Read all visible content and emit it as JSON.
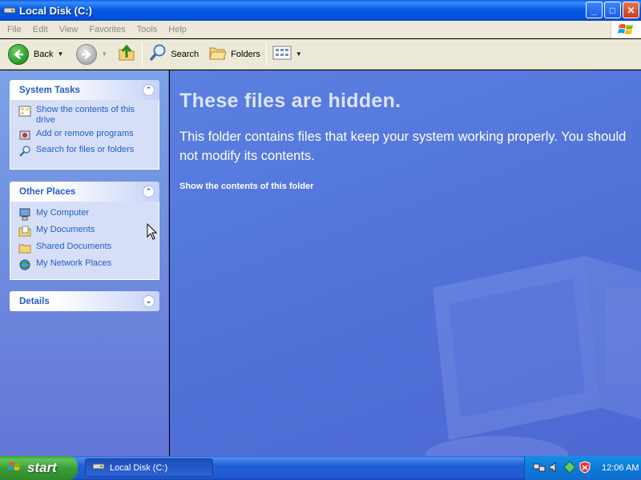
{
  "window": {
    "title": "Local Disk (C:)",
    "buttons": {
      "minimize": "_",
      "maximize": "□",
      "close": "✕"
    }
  },
  "menubar": {
    "items": [
      "File",
      "Edit",
      "View",
      "Favorites",
      "Tools",
      "Help"
    ]
  },
  "toolbar": {
    "back_label": "Back",
    "search_label": "Search",
    "folders_label": "Folders"
  },
  "sidebar": {
    "system_tasks": {
      "title": "System Tasks",
      "items": [
        {
          "label": "Show the contents of this drive",
          "icon": "show-contents-icon"
        },
        {
          "label": "Add or remove programs",
          "icon": "add-remove-programs-icon"
        },
        {
          "label": "Search for files or folders",
          "icon": "search-icon"
        }
      ]
    },
    "other_places": {
      "title": "Other Places",
      "items": [
        {
          "label": "My Computer",
          "icon": "my-computer-icon"
        },
        {
          "label": "My Documents",
          "icon": "my-documents-icon"
        },
        {
          "label": "Shared Documents",
          "icon": "shared-documents-icon"
        },
        {
          "label": "My Network Places",
          "icon": "network-places-icon"
        }
      ]
    },
    "details": {
      "title": "Details"
    }
  },
  "main": {
    "headline": "These files are hidden.",
    "message": "This folder contains files that keep your system working properly. You should not modify its contents.",
    "link": "Show the contents of this folder"
  },
  "taskbar": {
    "start_label": "start",
    "task_button": "Local Disk (C:)",
    "clock": "12:06 AM"
  },
  "colors": {
    "titlebar": "#0758e2",
    "sidebar_link": "#215dc6",
    "main_bg": "#5a80e0",
    "start_green": "#3a9b36"
  }
}
